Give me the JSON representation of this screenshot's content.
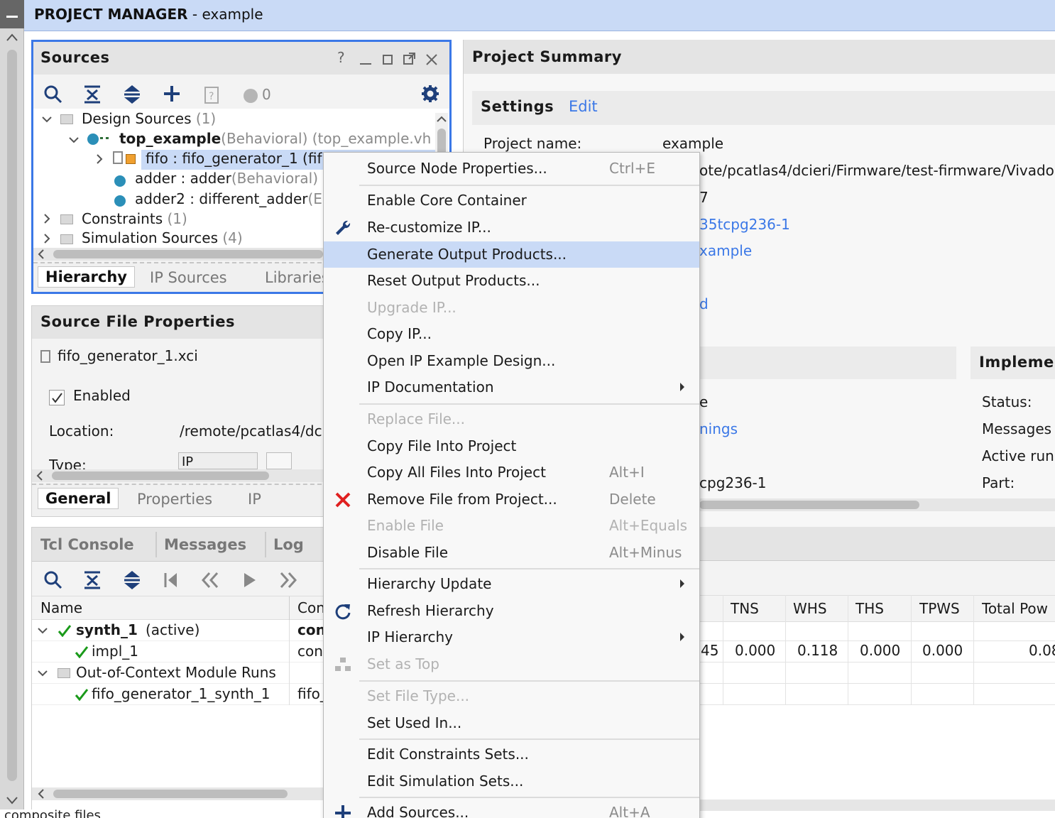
{
  "window": {
    "title_bold": "PROJECT MANAGER",
    "title_rest": " - example"
  },
  "sources": {
    "title": "Sources",
    "toolbar": {
      "count": "0"
    },
    "tree": {
      "design_sources": {
        "label": "Design Sources",
        "count": "(1)"
      },
      "top": {
        "name": "top_example",
        "rest": "(Behavioral) (top_example.vh"
      },
      "fifo": "fifo : fifo_generator_1 (fif",
      "adder": {
        "name": "adder : adder",
        "rest": "(Behavioral)"
      },
      "adder2": {
        "name": "adder2 : different_adder",
        "rest": "(E"
      },
      "constraints": {
        "label": "Constraints",
        "count": "(1)"
      },
      "simulation": {
        "label": "Simulation Sources",
        "count": "(4)"
      }
    },
    "tabs": [
      "Hierarchy",
      "IP Sources",
      "Libraries"
    ]
  },
  "source_file_properties": {
    "title": "Source File Properties",
    "file": "fifo_generator_1.xci",
    "enabled_label": "Enabled",
    "location_label": "Location:",
    "location_value": "/remote/pcatlas4/dc",
    "type_label": "Type:",
    "type_value": "IP",
    "tabs": [
      "General",
      "Properties",
      "IP"
    ]
  },
  "console": {
    "tabs": [
      "Tcl Console",
      "Messages",
      "Log"
    ],
    "columns": [
      "Name",
      "Con"
    ],
    "rows": [
      {
        "name": "synth_1",
        "extra": "(active)",
        "col2": "con"
      },
      {
        "name": "impl_1",
        "col2": "con"
      },
      {
        "name": "Out-of-Context Module Runs"
      },
      {
        "name": "fifo_generator_1_synth_1",
        "col2": "fifo_"
      }
    ]
  },
  "summary": {
    "title": "Project Summary",
    "settings_label": "Settings",
    "edit_link": "Edit",
    "project_name_label": "Project name:",
    "project_name_value": "example",
    "location_value": "ote/pcatlas4/dcieri/Firmware/test-firmware/Vivado",
    "frag1": "7",
    "part_link": "35tcpg236-1",
    "top_link": "xample",
    "frag2": "d",
    "impl_title": "Implemen",
    "impl_labels": [
      "Status:",
      "Messages",
      "Active run",
      "Part:"
    ],
    "left_frags": [
      "e",
      "nings",
      "cpg236-1"
    ]
  },
  "runs": {
    "columns": [
      "TNS",
      "WHS",
      "THS",
      "TPWS",
      "Total Pow"
    ],
    "row1_frag": "45",
    "row1": [
      "0.000",
      "0.118",
      "0.000",
      "0.000",
      "0.08"
    ]
  },
  "context_menu": {
    "items": [
      {
        "label": "Source Node Properties...",
        "shortcut": "Ctrl+E"
      },
      {
        "label": "Enable Core Container"
      },
      {
        "label": "Re-customize IP...",
        "icon": "wrench-icon"
      },
      {
        "label": "Generate Output Products...",
        "highlighted": true
      },
      {
        "label": "Reset Output Products..."
      },
      {
        "label": "Upgrade IP...",
        "disabled": true
      },
      {
        "label": "Copy IP..."
      },
      {
        "label": "Open IP Example Design..."
      },
      {
        "label": "IP Documentation",
        "submenu": true
      },
      {
        "label": "Replace File...",
        "disabled": true
      },
      {
        "label": "Copy File Into Project"
      },
      {
        "label": "Copy All Files Into Project",
        "shortcut": "Alt+I"
      },
      {
        "label": "Remove File from Project...",
        "shortcut": "Delete",
        "icon": "remove-x-icon"
      },
      {
        "label": "Enable File",
        "shortcut": "Alt+Equals",
        "disabled": true
      },
      {
        "label": "Disable File",
        "shortcut": "Alt+Minus"
      },
      {
        "label": "Hierarchy Update",
        "submenu": true
      },
      {
        "label": "Refresh Hierarchy",
        "icon": "refresh-icon"
      },
      {
        "label": "IP Hierarchy",
        "submenu": true
      },
      {
        "label": "Set as Top",
        "disabled": true,
        "icon": "hierarchy-icon"
      },
      {
        "label": "Set File Type...",
        "disabled": true
      },
      {
        "label": "Set Used In..."
      },
      {
        "label": "Edit Constraints Sets..."
      },
      {
        "label": "Edit Simulation Sets..."
      },
      {
        "label": "Add Sources...",
        "shortcut": "Alt+A",
        "icon": "plus-icon"
      }
    ]
  },
  "status_bar": {
    "text": "composite files"
  },
  "colors": {
    "accent": "#3b78e7",
    "highlight": "#c9daf6",
    "check": "#1a9a1a",
    "remove": "#e02020"
  }
}
